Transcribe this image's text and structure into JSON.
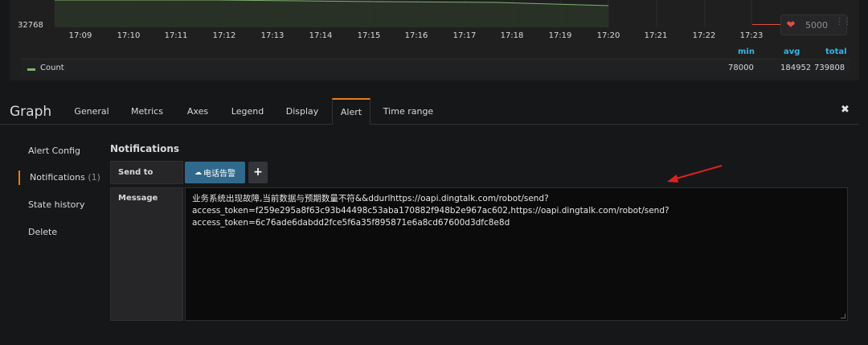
{
  "chart": {
    "y_min_label": "32768",
    "x_ticks": [
      "17:09",
      "17:10",
      "17:11",
      "17:12",
      "17:13",
      "17:14",
      "17:15",
      "17:16",
      "17:17",
      "17:18",
      "17:19",
      "17:20",
      "17:21",
      "17:22",
      "17:23"
    ],
    "threshold_value": "5000",
    "series_color": "#7eb26d",
    "threshold_color": "#e24d42"
  },
  "legend": {
    "headers": {
      "min": "min",
      "avg": "avg",
      "total": "total"
    },
    "rows": [
      {
        "name": "Count",
        "min": "78000",
        "avg": "184952",
        "total": "739808"
      }
    ]
  },
  "editor": {
    "title": "Graph",
    "close_icon": "close-icon",
    "tabs": [
      {
        "label": "General",
        "active": false
      },
      {
        "label": "Metrics",
        "active": false
      },
      {
        "label": "Axes",
        "active": false
      },
      {
        "label": "Legend",
        "active": false
      },
      {
        "label": "Display",
        "active": false
      },
      {
        "label": "Alert",
        "active": true
      },
      {
        "label": "Time range",
        "active": false
      }
    ],
    "accent_color": "#eb7b18"
  },
  "alert": {
    "sidebar": [
      {
        "label": "Alert Config"
      },
      {
        "label": "Notifications",
        "count": "(1)",
        "active": true
      },
      {
        "label": "State history"
      },
      {
        "label": "Delete"
      }
    ],
    "section_title": "Notifications",
    "send_to_label": "Send to",
    "channel_chip": "电话告警",
    "channel_icon": "cloud-icon",
    "add_label": "+",
    "message_label": "Message",
    "message_text": "业务系统出现故障,当前数据与预期数量不符&&ddurlhttps://oapi.dingtalk.com/robot/send?\naccess_token=f259e295a8f63c93b44498c53aba170882f948b2e967ac602,https://oapi.dingtalk.com/robot/send?\naccess_token=6c76ade6dabdd2fce5f6a35f895871e6a8cd67600d3dfc8e8d"
  }
}
